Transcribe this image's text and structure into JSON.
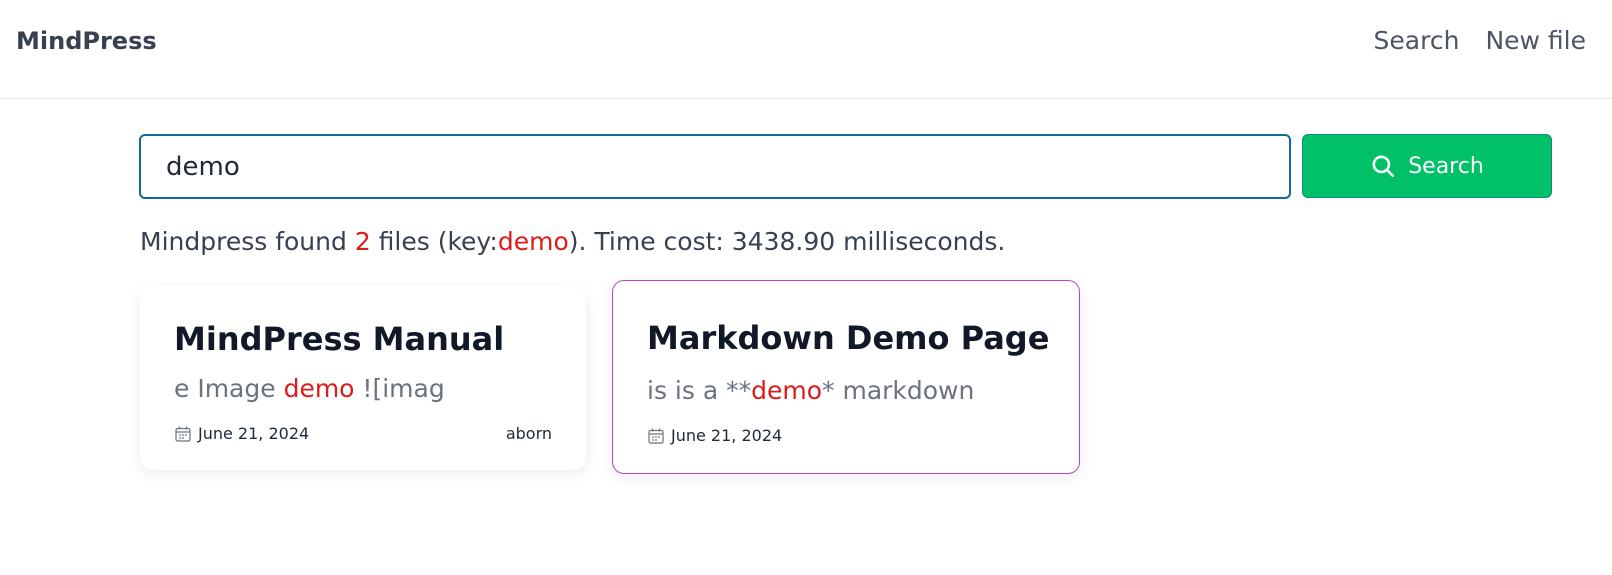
{
  "header": {
    "brand": "MindPress",
    "nav": {
      "search": "Search",
      "new_file": "New file"
    }
  },
  "search": {
    "value": "demo",
    "button_label": "Search",
    "button_icon": "search-icon"
  },
  "result": {
    "prefix": "Mindpress found ",
    "count": "2",
    "middle": " files (key:",
    "key": "demo",
    "suffix": "). Time cost: 3438.90 milliseconds."
  },
  "cards": [
    {
      "title": "MindPress Manual",
      "excerpt_before": "e Image ",
      "excerpt_match": "demo",
      "excerpt_after": " ![imag",
      "date": "June 21, 2024",
      "author": "aborn"
    },
    {
      "title": "Markdown Demo Page",
      "excerpt_before": "is is a **",
      "excerpt_match": "demo",
      "excerpt_after": "* markdown",
      "date": "June 21, 2024",
      "author": ""
    }
  ],
  "colors": {
    "accent_green": "#00c167",
    "highlight_red": "#dc1c1c",
    "input_border": "#0e6a9c",
    "selected_card_border": "#b04bbd"
  }
}
